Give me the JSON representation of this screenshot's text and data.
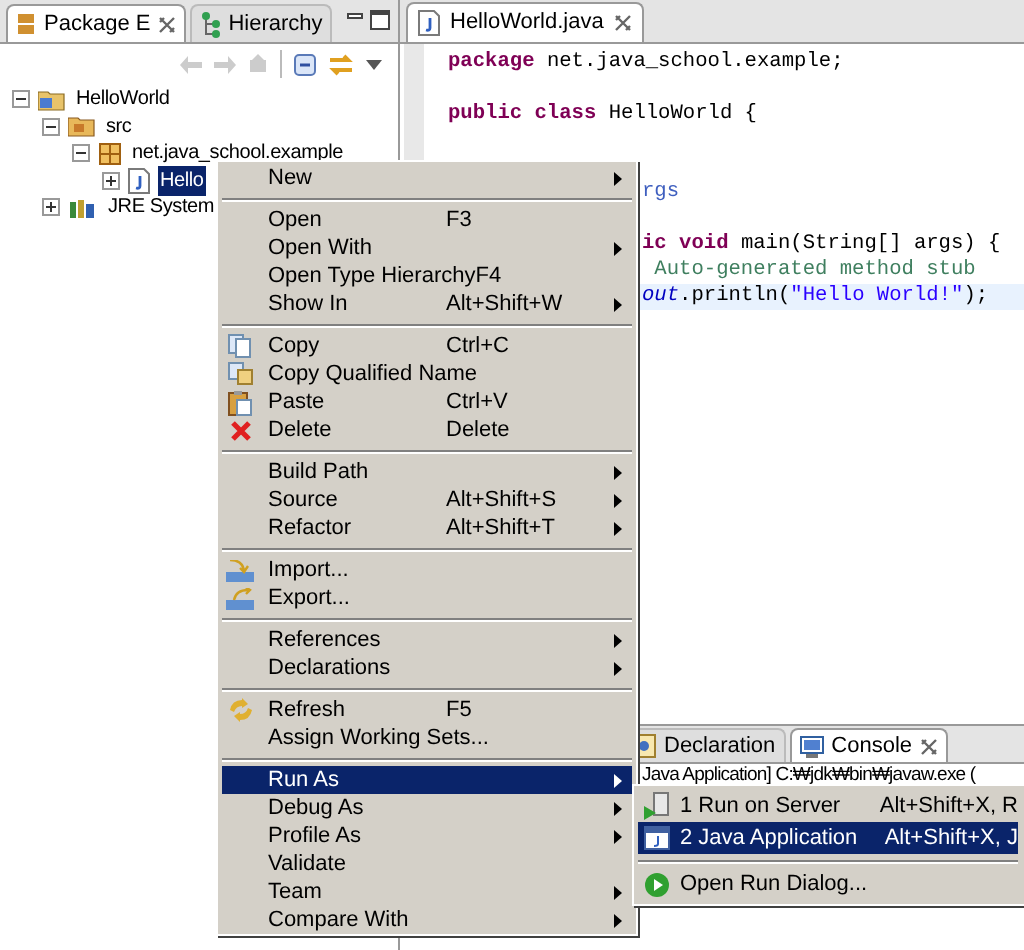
{
  "explorer": {
    "tabs": [
      {
        "label": "Package E",
        "selected": true,
        "closable": true
      },
      {
        "label": "Hierarchy",
        "selected": false,
        "closable": false
      }
    ],
    "tree": [
      {
        "label": "HelloWorld",
        "expanded": true,
        "kind": "project",
        "selected": false,
        "children": [
          {
            "label": "src",
            "expanded": true,
            "kind": "folder",
            "selected": false,
            "children": [
              {
                "label": "net.java_school.example",
                "expanded": true,
                "kind": "package",
                "selected": false,
                "children": [
                  {
                    "label": "Hello",
                    "expanded": false,
                    "kind": "java",
                    "selected": true
                  }
                ]
              }
            ]
          },
          {
            "label": "JRE System",
            "expanded": false,
            "kind": "library",
            "selected": false
          }
        ]
      }
    ]
  },
  "editor": {
    "tab": {
      "label": "HelloWorld.java"
    },
    "lines": [
      {
        "kind": "full",
        "segments": [
          {
            "kind": "keyword",
            "text": "package"
          },
          {
            "kind": "plain",
            "text": " net.java_school.example;"
          }
        ]
      },
      {
        "kind": "blank"
      },
      {
        "kind": "full",
        "segments": [
          {
            "kind": "keyword",
            "text": "public class"
          },
          {
            "kind": "plain",
            "text": " HelloWorld {"
          }
        ]
      },
      {
        "kind": "blank"
      },
      {
        "kind": "blank"
      },
      {
        "kind": "clipped",
        "segments": [
          {
            "kind": "javadoc",
            "text": "rgs"
          }
        ]
      },
      {
        "kind": "blank"
      },
      {
        "kind": "clipped",
        "segments": [
          {
            "kind": "keyword",
            "text": "ic void"
          },
          {
            "kind": "plain",
            "text": " main(String[] args) {"
          }
        ]
      },
      {
        "kind": "clipped",
        "segments": [
          {
            "kind": "comment",
            "text": " Auto-generated method stub"
          }
        ]
      },
      {
        "kind": "clipped",
        "current": true,
        "segments": [
          {
            "kind": "static",
            "text": "out"
          },
          {
            "kind": "plain",
            "text": ".println("
          },
          {
            "kind": "string",
            "text": "\"Hello World!\""
          },
          {
            "kind": "plain",
            "text": ");"
          }
        ]
      }
    ]
  },
  "bottom_panel": {
    "tabs": [
      {
        "label": "Declaration",
        "selected": false
      },
      {
        "label": "Console",
        "selected": true
      }
    ],
    "console_header": "Java Application] C:₩jdk₩bin₩javaw.exe ("
  },
  "context_menu": {
    "items": [
      {
        "kind": "item",
        "label": "New",
        "submenu": true
      },
      {
        "kind": "separator"
      },
      {
        "kind": "item",
        "label": "Open",
        "shortcut": "F3"
      },
      {
        "kind": "item",
        "label": "Open With",
        "submenu": true
      },
      {
        "kind": "item",
        "label": "Open Type Hierarchy",
        "shortcut": "F4"
      },
      {
        "kind": "item",
        "label": "Show In",
        "shortcut": "Alt+Shift+W",
        "submenu": true
      },
      {
        "kind": "separator"
      },
      {
        "kind": "item",
        "label": "Copy",
        "shortcut": "Ctrl+C"
      },
      {
        "kind": "item",
        "label": "Copy Qualified Name"
      },
      {
        "kind": "item",
        "label": "Paste",
        "shortcut": "Ctrl+V"
      },
      {
        "kind": "item",
        "label": "Delete",
        "shortcut": "Delete"
      },
      {
        "kind": "separator"
      },
      {
        "kind": "item",
        "label": "Build Path",
        "submenu": true
      },
      {
        "kind": "item",
        "label": "Source",
        "shortcut": "Alt+Shift+S",
        "submenu": true
      },
      {
        "kind": "item",
        "label": "Refactor",
        "shortcut": "Alt+Shift+T",
        "submenu": true
      },
      {
        "kind": "separator"
      },
      {
        "kind": "item",
        "label": "Import..."
      },
      {
        "kind": "item",
        "label": "Export..."
      },
      {
        "kind": "separator"
      },
      {
        "kind": "item",
        "label": "References",
        "submenu": true
      },
      {
        "kind": "item",
        "label": "Declarations",
        "submenu": true
      },
      {
        "kind": "separator"
      },
      {
        "kind": "item",
        "label": "Refresh",
        "shortcut": "F5"
      },
      {
        "kind": "item",
        "label": "Assign Working Sets..."
      },
      {
        "kind": "separator"
      },
      {
        "kind": "item",
        "label": "Run As",
        "submenu": true,
        "selected": true
      },
      {
        "kind": "item",
        "label": "Debug As",
        "submenu": true
      },
      {
        "kind": "item",
        "label": "Profile As",
        "submenu": true
      },
      {
        "kind": "item",
        "label": "Validate"
      },
      {
        "kind": "item",
        "label": "Team",
        "submenu": true
      },
      {
        "kind": "item",
        "label": "Compare With",
        "submenu": true
      }
    ]
  },
  "run_as_submenu": {
    "items": [
      {
        "kind": "item",
        "label": "1 Run on Server",
        "shortcut": "Alt+Shift+X, R",
        "selected": false
      },
      {
        "kind": "item",
        "label": "2 Java Application",
        "shortcut": "Alt+Shift+X, J",
        "selected": true
      },
      {
        "kind": "separator"
      },
      {
        "kind": "item",
        "label": "Open Run Dialog...",
        "selected": false
      }
    ]
  }
}
